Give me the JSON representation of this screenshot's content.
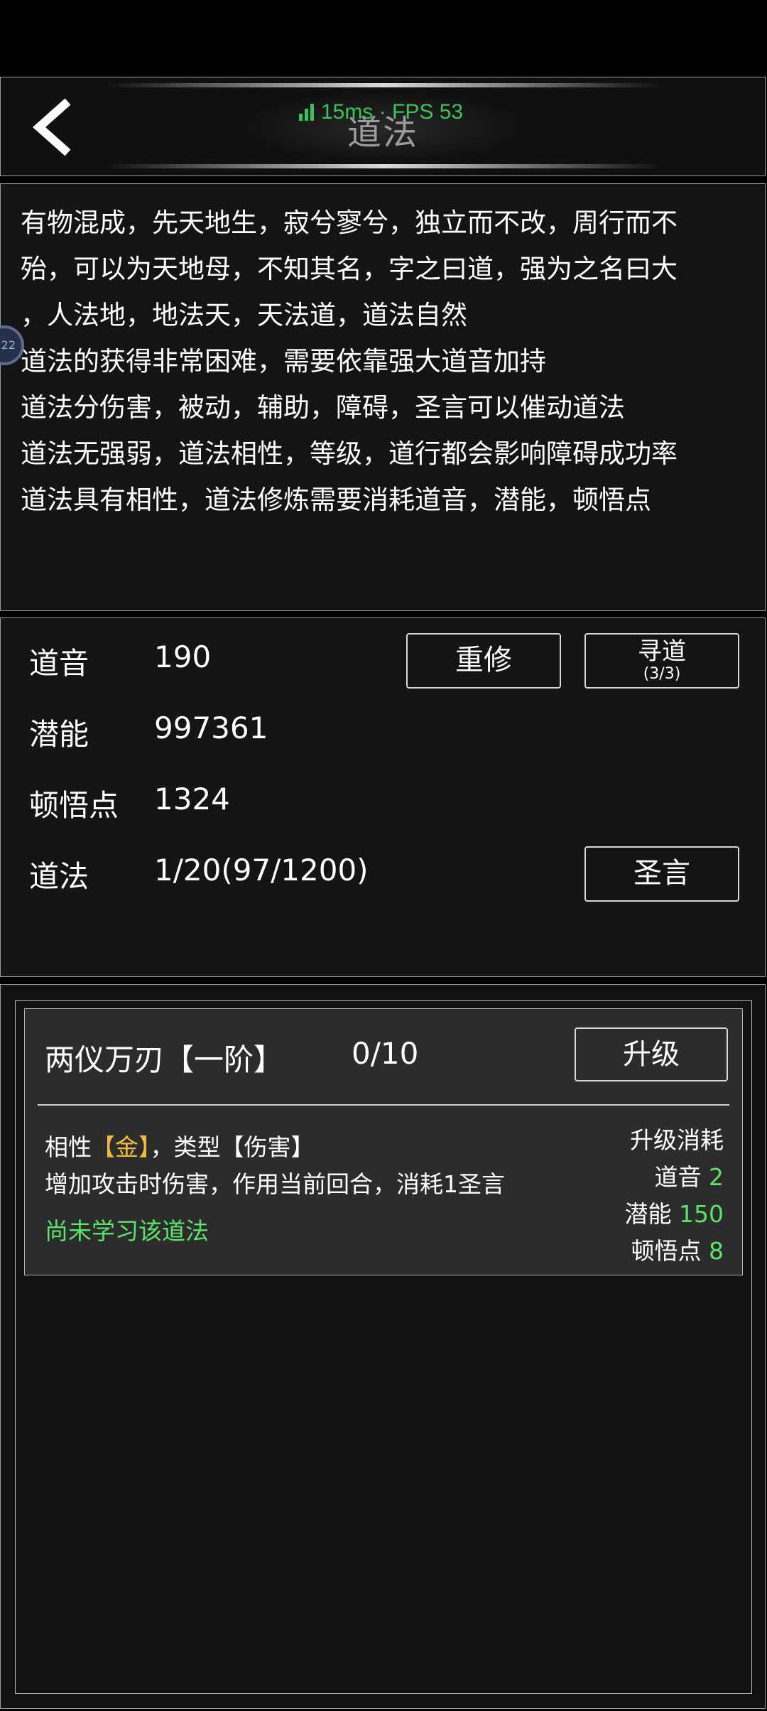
{
  "header": {
    "title": "道法",
    "perf": "15ms · FPS 53"
  },
  "description": {
    "lines": [
      "有物混成，先天地生，寂兮寥兮，独立而不改，周行而不",
      "殆，可以为天地母，不知其名，字之曰道，强为之名曰大",
      "，人法地，地法天，天法道，道法自然",
      "道法的获得非常困难，需要依靠强大道音加持",
      "道法分伤害，被动，辅助，障碍，圣言可以催动道法",
      "道法无强弱，道法相性，等级，道行都会影响障碍成功率",
      "道法具有相性，道法修炼需要消耗道音，潜能，顿悟点"
    ],
    "float_badge": "22"
  },
  "stats": {
    "rows": [
      {
        "label": "道音",
        "value": "190"
      },
      {
        "label": "潜能",
        "value": "997361"
      },
      {
        "label": "顿悟点",
        "value": "1324"
      },
      {
        "label": "道法",
        "value": "1/20(97/1200)"
      }
    ],
    "reset_label": "重修",
    "seek_label": "寻道",
    "seek_count": "(3/3)",
    "holy_label": "圣言"
  },
  "technique": {
    "name": "两仪万刃【一阶】",
    "level": "0/10",
    "upgrade_label": "升级",
    "affinity_prefix": "相性",
    "affinity_value": "【金】",
    "type_text": "，类型【伤害】",
    "effect": "增加攻击时伤害，作用当前回合，消耗1圣言",
    "status": "尚未学习该道法",
    "cost_title": "升级消耗",
    "costs": [
      {
        "label": "道音",
        "value": "2"
      },
      {
        "label": "潜能",
        "value": "150"
      },
      {
        "label": "顿悟点",
        "value": "8"
      }
    ]
  },
  "colors": {
    "accent_green": "#5be36b",
    "affinity_gold": "#f2b93b",
    "perf_green": "#38c45a"
  }
}
